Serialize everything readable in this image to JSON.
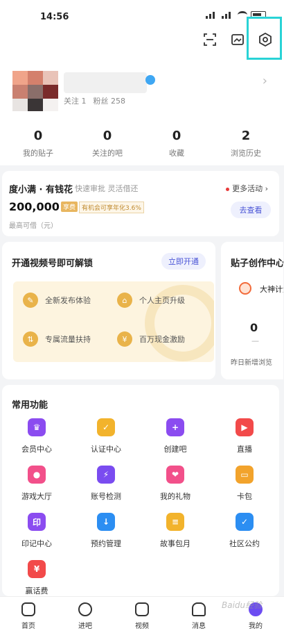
{
  "status_bar": {
    "time": "14:56"
  },
  "profile": {
    "follow_label": "关注",
    "follow_count": "1",
    "fans_label": "粉丝",
    "fans_count": "258"
  },
  "stats": [
    {
      "value": "0",
      "label": "我的贴子"
    },
    {
      "value": "0",
      "label": "关注的吧"
    },
    {
      "value": "0",
      "label": "收藏"
    },
    {
      "value": "2",
      "label": "浏览历史"
    }
  ],
  "loan": {
    "title": "度小满 · 有钱花",
    "subtitle": "快速审批 灵活借还",
    "more": "更多活动",
    "amount": "200,000",
    "tag": "享费",
    "rate": "有机会可享年化3.6%",
    "caption": "最高可借（元）",
    "button": "去查看"
  },
  "video": {
    "title": "开通视频号即可解锁",
    "button": "立即开通",
    "perks": [
      {
        "icon": "pencil-icon",
        "label": "全新发布体验"
      },
      {
        "icon": "home-icon",
        "label": "个人主页升级"
      },
      {
        "icon": "boost-icon",
        "label": "专属流量扶持"
      },
      {
        "icon": "yen-icon",
        "label": "百万现金激励"
      }
    ]
  },
  "create": {
    "title": "贴子创作中心",
    "user": "大神计划",
    "value": "0",
    "dash": "—",
    "label": "昨日新增浏览"
  },
  "functions": {
    "title": "常用功能",
    "items": [
      {
        "label": "会员中心",
        "icon": "crown-icon",
        "color": "#8b4cf0"
      },
      {
        "label": "认证中心",
        "icon": "badge-icon",
        "color": "#f2b32c"
      },
      {
        "label": "创建吧",
        "icon": "plus-icon",
        "color": "#8b4cf0"
      },
      {
        "label": "直播",
        "icon": "camera-icon",
        "color": "#f24a4a"
      },
      {
        "label": "游戏大厅",
        "icon": "game-icon",
        "color": "#f2508a"
      },
      {
        "label": "账号检测",
        "icon": "shield-icon",
        "color": "#7a4cf0"
      },
      {
        "label": "我的礼物",
        "icon": "gift-icon",
        "color": "#f2508a"
      },
      {
        "label": "卡包",
        "icon": "ticket-icon",
        "color": "#f2a32c"
      },
      {
        "label": "印记中心",
        "icon": "stamp-icon",
        "color": "#8b4cf0"
      },
      {
        "label": "预约管理",
        "icon": "download-icon",
        "color": "#2c8ef2"
      },
      {
        "label": "故事包月",
        "icon": "book-icon",
        "color": "#f2b32c"
      },
      {
        "label": "社区公约",
        "icon": "rules-icon",
        "color": "#2c8ef2"
      },
      {
        "label": "赢话费",
        "icon": "coupon-icon",
        "color": "#f24a4a"
      }
    ]
  },
  "tabs": [
    {
      "label": "首页"
    },
    {
      "label": "进吧"
    },
    {
      "label": "视频"
    },
    {
      "label": "消息"
    },
    {
      "label": "我的"
    }
  ],
  "watermark": "Baidu经验"
}
